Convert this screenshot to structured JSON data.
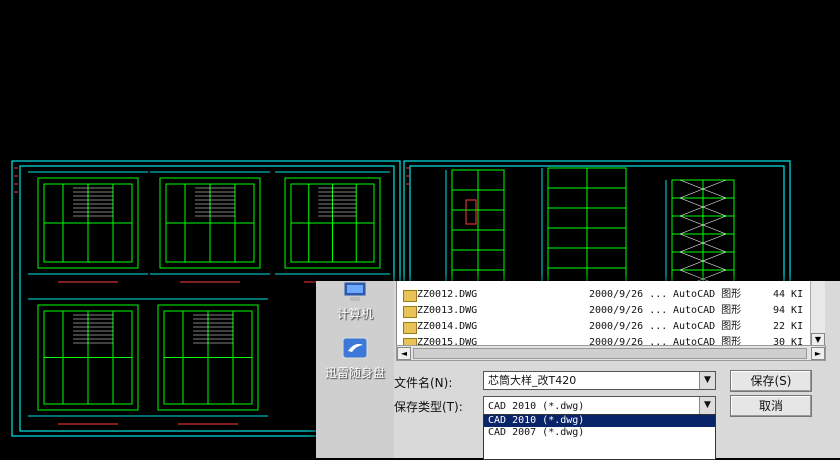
{
  "places": [
    {
      "label": "计算机",
      "icon": "computer-icon"
    },
    {
      "label": "迅雷随身盘",
      "icon": "thunder-drive-icon"
    }
  ],
  "files": [
    {
      "name": "ZZ0012.DWG",
      "date": "2000/9/26 ...",
      "type": "AutoCAD 图形",
      "size": "44 KI"
    },
    {
      "name": "ZZ0013.DWG",
      "date": "2000/9/26 ...",
      "type": "AutoCAD 图形",
      "size": "94 KI"
    },
    {
      "name": "ZZ0014.DWG",
      "date": "2000/9/26 ...",
      "type": "AutoCAD 图形",
      "size": "22 KI"
    },
    {
      "name": "ZZ0015.DWG",
      "date": "2000/9/26 ...",
      "type": "AutoCAD 图形",
      "size": "30 KI"
    }
  ],
  "form": {
    "filename_label": "文件名(N):",
    "filename_value": "芯筒大样_改T420",
    "filetype_label": "保存类型(T):",
    "filetype_value": "CAD 2010 (*.dwg)"
  },
  "buttons": {
    "save": "保存(S)",
    "cancel": "取消"
  },
  "filetype_options": [
    {
      "label": "CAD 2010 (*.dwg)",
      "selected": true
    },
    {
      "label": "CAD 2007 (*.dwg)",
      "selected": false
    }
  ],
  "colors": {
    "cad_background": "#000000",
    "cad_lines": "#00ff00",
    "cad_frame": "#00e5e5",
    "selection": "#0a246a"
  }
}
